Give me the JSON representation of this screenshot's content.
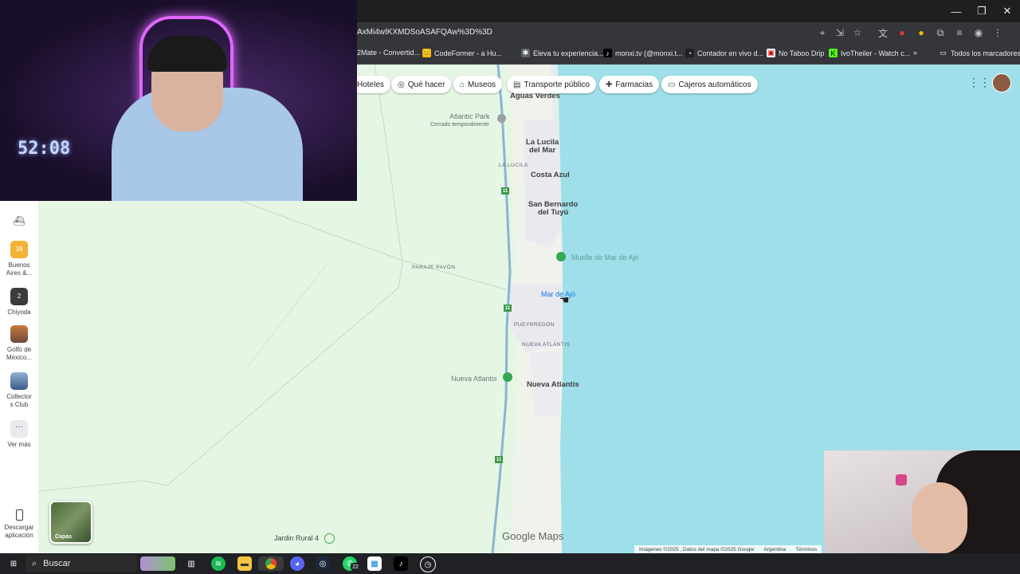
{
  "browser": {
    "url": "AxMi4wIKXMDSoASAFQAw%3D%3D",
    "window_controls": [
      "—",
      "❐",
      "✕"
    ],
    "bookmarks": [
      {
        "label": "2Mate - Convertid...",
        "icon": "▶"
      },
      {
        "label": "CodeFormer - a Hu...",
        "icon": "😊"
      },
      {
        "label": "Eleva tu experiencia...",
        "icon": "✱"
      },
      {
        "label": "monxi.tv (@monxi.t...",
        "icon": "♪"
      },
      {
        "label": "Contador en vivo d...",
        "icon": "◔"
      },
      {
        "label": "No Taboo Drip",
        "icon": "▣"
      },
      {
        "label": "IvoTheiler - Watch c...",
        "icon": "K"
      },
      {
        "label": "Todos los marcadores",
        "icon": "▭"
      }
    ],
    "more_bookmarks": "»"
  },
  "maps": {
    "chips": [
      {
        "label": "Hoteles",
        "icon": ""
      },
      {
        "label": "Qué hacer",
        "icon": "◎"
      },
      {
        "label": "Museos",
        "icon": "⌂"
      },
      {
        "label": "Transporte público",
        "icon": "▤"
      },
      {
        "label": "Farmacias",
        "icon": "✚"
      },
      {
        "label": "Cajeros automáticos",
        "icon": "▭"
      }
    ],
    "labels": {
      "aguas_verdes": "Aguas Verdes",
      "atlantic_park": "Atlantic Park",
      "cerrado": "Cerrado temporalmente",
      "la_lucila_del_mar": "La Lucila\ndel Mar",
      "la_lucila": "LA LUCILA",
      "costa_azul": "Costa Azul",
      "san_bernardo": "San Bernardo\ndel Tuyú",
      "muelle": "Muelle de Mar de Ajó",
      "paraje_pavon": "PARAJE PAVÓN",
      "mar_de_ajo": "Mar de Ajó",
      "pueyrredon": "PUEYRREDÓN",
      "nueva_atlantis_small": "NUEVA ATLANTIS",
      "nueva_atlantis_poi": "Nueva Atlantis",
      "nueva_atlantis": "Nueva Atlantis",
      "jardin_rural": "Jardin Rural 4",
      "route_11": "11"
    },
    "rail": [
      {
        "label": "",
        "thumb_color": "#cfd8dc"
      },
      {
        "label": "Buenos\nAires &...",
        "thumb_color": "#f2b233",
        "badge": "38"
      },
      {
        "label": "Chiyoda",
        "thumb_color": "#3c3c3c",
        "badge": "2"
      },
      {
        "label": "Golfo de\nMéxico...",
        "thumb_color": "#c87a3b"
      },
      {
        "label": "Collector\ns Club",
        "thumb_color": "#5b7fb2"
      },
      {
        "label": "Ver más",
        "thumb_color": "#e8eaed"
      },
      {
        "label": "Descargar\naplicación",
        "thumb_color": "#ffffff"
      }
    ],
    "layers_label": "Capas",
    "logo": "Google Maps",
    "attribution": [
      "Imágenes ©2025 , Datos del mapa ©2025 Google",
      "Argentina",
      "Términos"
    ]
  },
  "taskbar": {
    "search_label": "Buscar",
    "whatsapp_badge": "22"
  },
  "overlay": {
    "clock": "52:08"
  }
}
